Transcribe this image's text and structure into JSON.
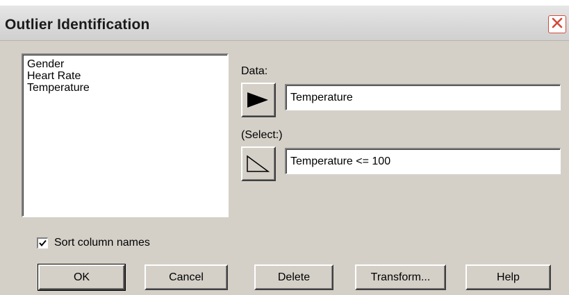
{
  "window": {
    "title": "Outlier Identification"
  },
  "variables": {
    "items": [
      "Gender",
      "Heart Rate",
      "Temperature"
    ]
  },
  "data_field": {
    "label": "Data:",
    "value": "Temperature"
  },
  "select_field": {
    "label": "(Select:)",
    "value": "Temperature <= 100"
  },
  "sort_option": {
    "label": "Sort column names",
    "checked": true
  },
  "buttons": {
    "ok": "OK",
    "cancel": "Cancel",
    "delete": "Delete",
    "transform": "Transform...",
    "help": "Help"
  },
  "icons": {
    "close": "close-icon",
    "data_arrow": "play-filled-icon",
    "select_arrow": "play-outline-icon",
    "check": "checkmark-icon"
  },
  "colors": {
    "dialog_bg": "#d4d0c8",
    "close_accent": "#d24a3a"
  }
}
